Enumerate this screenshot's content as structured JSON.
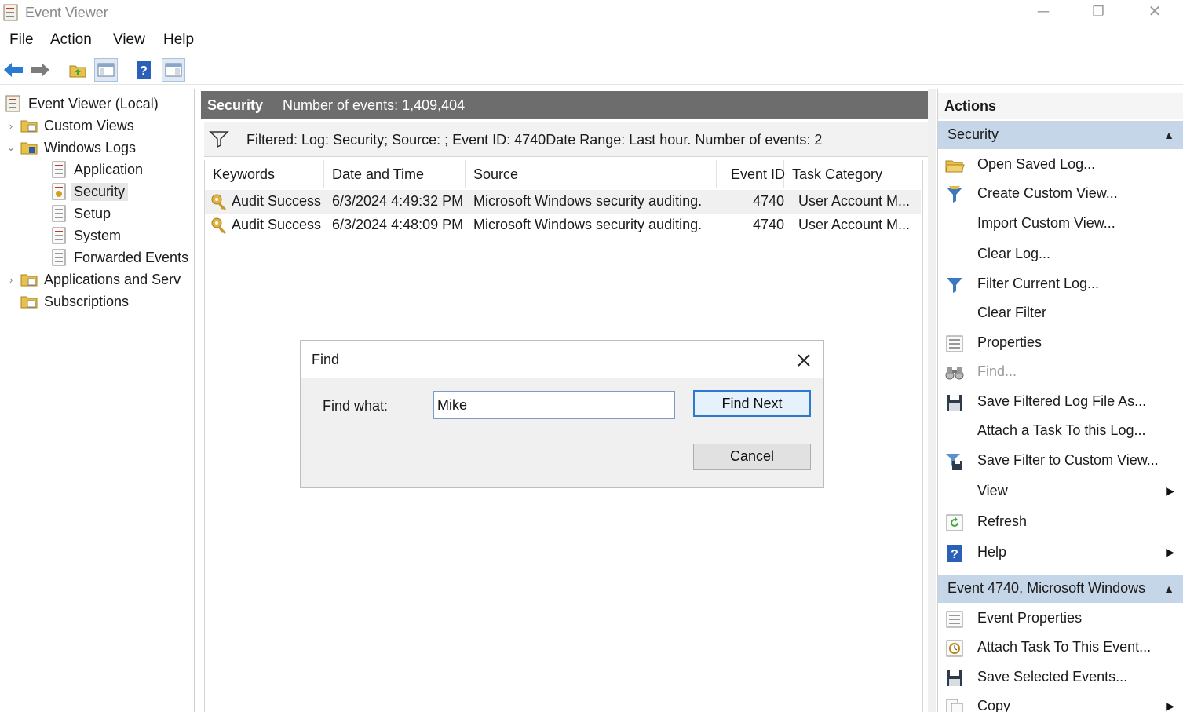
{
  "window": {
    "title": "Event Viewer",
    "minimize": "─",
    "restore": "❐",
    "close": "✕"
  },
  "menu": {
    "items": [
      "File",
      "Action",
      "View",
      "Help"
    ]
  },
  "tree": {
    "root": "Event Viewer (Local)",
    "custom_views": "Custom Views",
    "windows_logs": "Windows Logs",
    "application": "Application",
    "security": "Security",
    "setup": "Setup",
    "system": "System",
    "forwarded_events": "Forwarded Events",
    "apps_services": "Applications and Serv",
    "subscriptions": "Subscriptions"
  },
  "center": {
    "log_name": "Security",
    "event_count": "Number of events: 1,409,404",
    "filter_text": "Filtered: Log: Security; Source: ; Event ID: 4740Date Range: Last hour. Number of events: 2",
    "columns": [
      "Keywords",
      "Date and Time",
      "Source",
      "Event ID",
      "Task Category"
    ],
    "rows": [
      {
        "keywords": "Audit Success",
        "datetime": "6/3/2024 4:49:32 PM",
        "source": "Microsoft Windows security auditing.",
        "event_id": "4740",
        "task": "User Account M..."
      },
      {
        "keywords": "Audit Success",
        "datetime": "6/3/2024 4:48:09 PM",
        "source": "Microsoft Windows security auditing.",
        "event_id": "4740",
        "task": "User Account M..."
      }
    ]
  },
  "actions": {
    "header": "Actions",
    "group1": "Security",
    "items1": [
      "Open Saved Log...",
      "Create Custom View...",
      "Import Custom View...",
      "Clear Log...",
      "Filter Current Log...",
      "Clear Filter",
      "Properties",
      "Find...",
      "Save Filtered Log File As...",
      "Attach a Task To this Log...",
      "Save Filter to Custom View...",
      "View",
      "Refresh",
      "Help"
    ],
    "group2": "Event 4740, Microsoft Windows",
    "items2": [
      "Event Properties",
      "Attach Task To This Event...",
      "Save Selected Events...",
      "Copy"
    ]
  },
  "find_dialog": {
    "title": "Find",
    "label": "Find what:",
    "value": "Mike",
    "find_next": "Find Next",
    "cancel": "Cancel"
  },
  "colors": {
    "header_bg": "#6d6d6d",
    "group_bg": "#c6d6e9",
    "accent": "#2b79d0"
  }
}
